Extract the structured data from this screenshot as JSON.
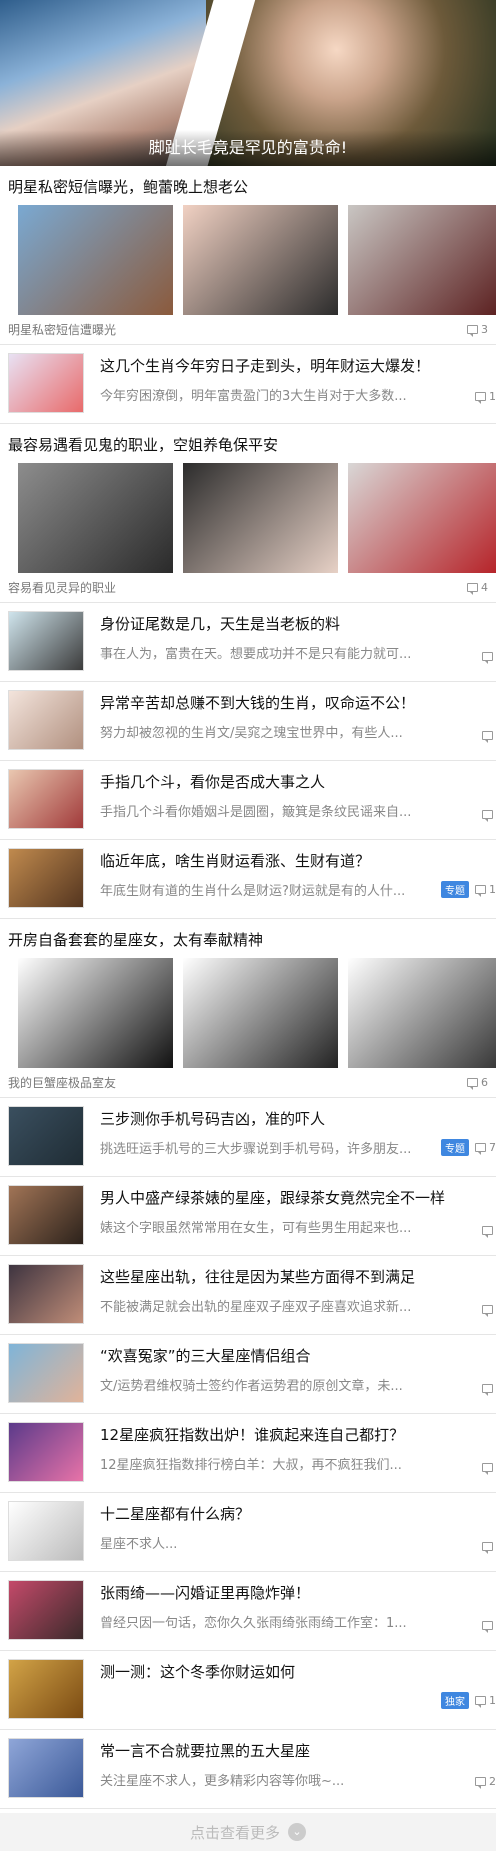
{
  "hero": {
    "caption": "脚趾长毛竟是罕见的富贵命!"
  },
  "groups": [
    {
      "title": "明星私密短信曝光，鲍蕾晚上想老公",
      "images": [
        {
          "icon": "beach-photo",
          "colors": [
            "#7aa9d2",
            "#8b5a3c"
          ]
        },
        {
          "icon": "couple-photo",
          "colors": [
            "#f1d1c3",
            "#2c2c2c"
          ]
        },
        {
          "icon": "airport-photo",
          "colors": [
            "#c9c6c3",
            "#5a1e1e"
          ]
        }
      ],
      "footer": "明星私密短信遭曝光",
      "comments": "3"
    },
    {
      "title": "最容易遇看见鬼的职业，空姐养龟保平安",
      "images": [
        {
          "icon": "car-photo",
          "colors": [
            "#8d8d8d",
            "#2a2a2a"
          ]
        },
        {
          "icon": "makeup-photo",
          "colors": [
            "#2c2c2c",
            "#e7d1c6"
          ]
        },
        {
          "icon": "hospital-photo",
          "colors": [
            "#d9d7d6",
            "#b51f25"
          ]
        }
      ],
      "footer": "容易看见灵异的职业",
      "comments": "4"
    },
    {
      "title": "开房自备套套的星座女，太有奉献精神",
      "images": [
        {
          "icon": "cancer-poster",
          "colors": [
            "#ffffff",
            "#111111"
          ]
        },
        {
          "icon": "meme-card-1",
          "colors": [
            "#ffffff",
            "#222222"
          ]
        },
        {
          "icon": "meme-card-2",
          "colors": [
            "#ffffff",
            "#333333"
          ]
        }
      ],
      "footer": "我的巨蟹座极品室友",
      "comments": "6"
    }
  ],
  "items_a": [
    {
      "title": "这几个生肖今年穷日子走到头，明年财运大爆发！",
      "summary": "今年穷困潦倒，明年富贵盈门的3大生肖对于大多数...",
      "comments": "1",
      "tag": "",
      "thumb": [
        "#e8e1f3",
        "#e86a6a"
      ]
    }
  ],
  "items_b": [
    {
      "title": "身份证尾数是几，天生是当老板的料",
      "summary": "事在人为，富贵在天。想要成功并不是只有能力就可...",
      "comments": "",
      "tag": "",
      "thumb": [
        "#cfe4ec",
        "#3b3b3b"
      ]
    },
    {
      "title": "异常辛苦却总赚不到大钱的生肖，叹命运不公！",
      "summary": "努力却被忽视的生肖文/吴窕之瑰宝世界中，有些人...",
      "comments": "",
      "tag": "",
      "thumb": [
        "#f3e4dc",
        "#b1907f"
      ]
    },
    {
      "title": "手指几个斗，看你是否成大事之人",
      "summary": "手指几个斗看你婚姻斗是圆圈，簸箕是条纹民谣来自...",
      "comments": "",
      "tag": "",
      "thumb": [
        "#e9c7b0",
        "#a13a3a"
      ]
    },
    {
      "title": "临近年底，啥生肖财运看涨、生财有道？",
      "summary": "年底生财有道的生肖什么是财运?财运就是有的人什...",
      "comments": "1",
      "tag": "专题",
      "thumb": [
        "#c08a4e",
        "#54351f"
      ]
    }
  ],
  "items_c": [
    {
      "title": "三步测你手机号码吉凶，准的吓人",
      "summary": "挑选旺运手机号的三大步骤说到手机号码，许多朋友...",
      "comments": "7",
      "tag": "专题",
      "thumb": [
        "#3a4f5f",
        "#1f2c34"
      ]
    },
    {
      "title": "男人中盛产绿茶婊的星座，跟绿茶女竟然完全不一样",
      "summary": "婊这个字眼虽然常常用在女生，可有些男生用起来也...",
      "comments": "",
      "tag": "",
      "thumb": [
        "#a17456",
        "#2c221b"
      ]
    },
    {
      "title": "这些星座出轨，往往是因为某些方面得不到满足",
      "summary": "不能被满足就会出轨的星座双子座双子座喜欢追求新...",
      "comments": "",
      "tag": "",
      "thumb": [
        "#3e3440",
        "#c08d78"
      ]
    },
    {
      "title": "“欢喜冤家”的三大星座情侣组合",
      "summary": "文/运势君维权骑士签约作者运势君的原创文章，未...",
      "comments": "",
      "tag": "",
      "thumb": [
        "#7fb4d8",
        "#e1b399"
      ]
    },
    {
      "title": "12星座疯狂指数出炉！谁疯起来连自己都打？",
      "summary": "12星座疯狂指数排行榜白羊：大叔，再不疯狂我们...",
      "comments": "",
      "tag": "",
      "thumb": [
        "#5b3a8a",
        "#e873a8"
      ]
    },
    {
      "title": "十二星座都有什么病？",
      "summary": "星座不求人...",
      "comments": "",
      "tag": "",
      "thumb": [
        "#ffffff",
        "#bbbbbb"
      ]
    },
    {
      "title": "张雨绮——闪婚证里再隐炸弹！",
      "summary": "曾经只因一句话，恋你久久张雨绮张雨绮工作室：1...",
      "comments": "",
      "tag": "",
      "thumb": [
        "#c44a6a",
        "#3a2a2a"
      ]
    },
    {
      "title": "测一测：这个冬季你财运如何",
      "summary": "",
      "comments": "1",
      "tag": "独家",
      "thumb": [
        "#d2a347",
        "#7a4a12"
      ]
    },
    {
      "title": "常一言不合就要拉黑的五大星座",
      "summary": "关注星座不求人，更多精彩内容等你哦~...",
      "comments": "2",
      "tag": "",
      "thumb": [
        "#8fa6d8",
        "#3b5998"
      ]
    }
  ],
  "more_label": "点击查看更多"
}
